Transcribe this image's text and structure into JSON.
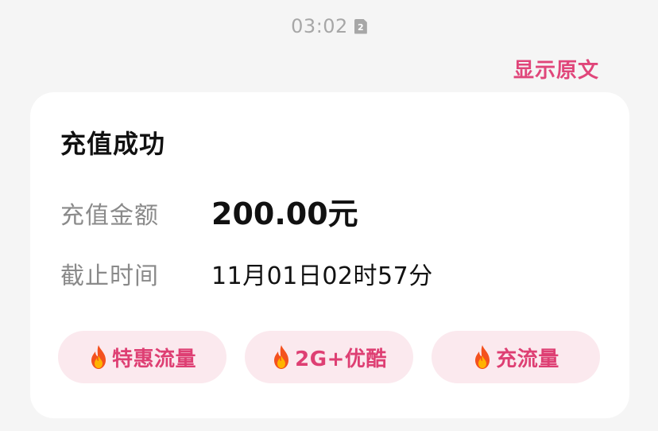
{
  "status": {
    "time": "03:02",
    "sim_slot": "2"
  },
  "header": {
    "show_original_label": "显示原文"
  },
  "card": {
    "title": "充值成功",
    "amount_label": "充值金额",
    "amount_value": "200.00元",
    "deadline_label": "截止时间",
    "deadline_value": "11月01日02时57分"
  },
  "actions": [
    {
      "label": "特惠流量",
      "icon": "fire-icon"
    },
    {
      "label": "2G+优酷",
      "icon": "fire-icon"
    },
    {
      "label": "充流量",
      "icon": "fire-icon"
    }
  ],
  "colors": {
    "accent": "#e0467a",
    "pill_bg": "#fbe9ee",
    "page_bg": "#f5f5f5"
  }
}
